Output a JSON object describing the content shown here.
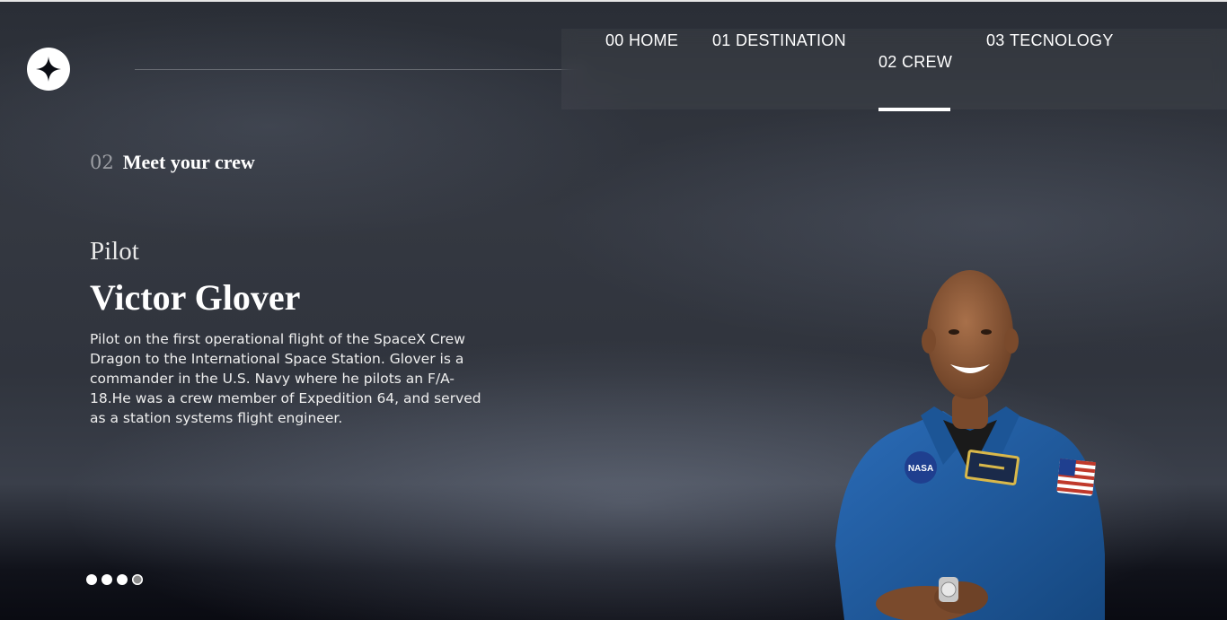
{
  "header": {
    "logo_icon": "star-icon",
    "nav": [
      {
        "num": "00",
        "label": "HOME"
      },
      {
        "num": "01",
        "label": "DESTINATION"
      },
      {
        "num": "02",
        "label": "CREW"
      },
      {
        "num": "03",
        "label": "TECNOLOGY"
      }
    ],
    "active_index": 2
  },
  "section": {
    "number": "02",
    "title": "Meet your crew"
  },
  "crew_member": {
    "role": "Pilot",
    "name": "Victor Glover",
    "bio": "Pilot on the first operational flight of the SpaceX Crew Dragon to the International Space Station. Glover is a commander in the U.S. Navy where he pilots an F/A-18.He was a crew member of Expedition 64, and served as a station systems flight engineer.",
    "badge_text": "NASA"
  },
  "pagination": {
    "count": 4,
    "active_index": 3
  },
  "colors": {
    "background": "#0b0d14",
    "accent": "#ffffff",
    "suit": "#1f5fa8"
  }
}
